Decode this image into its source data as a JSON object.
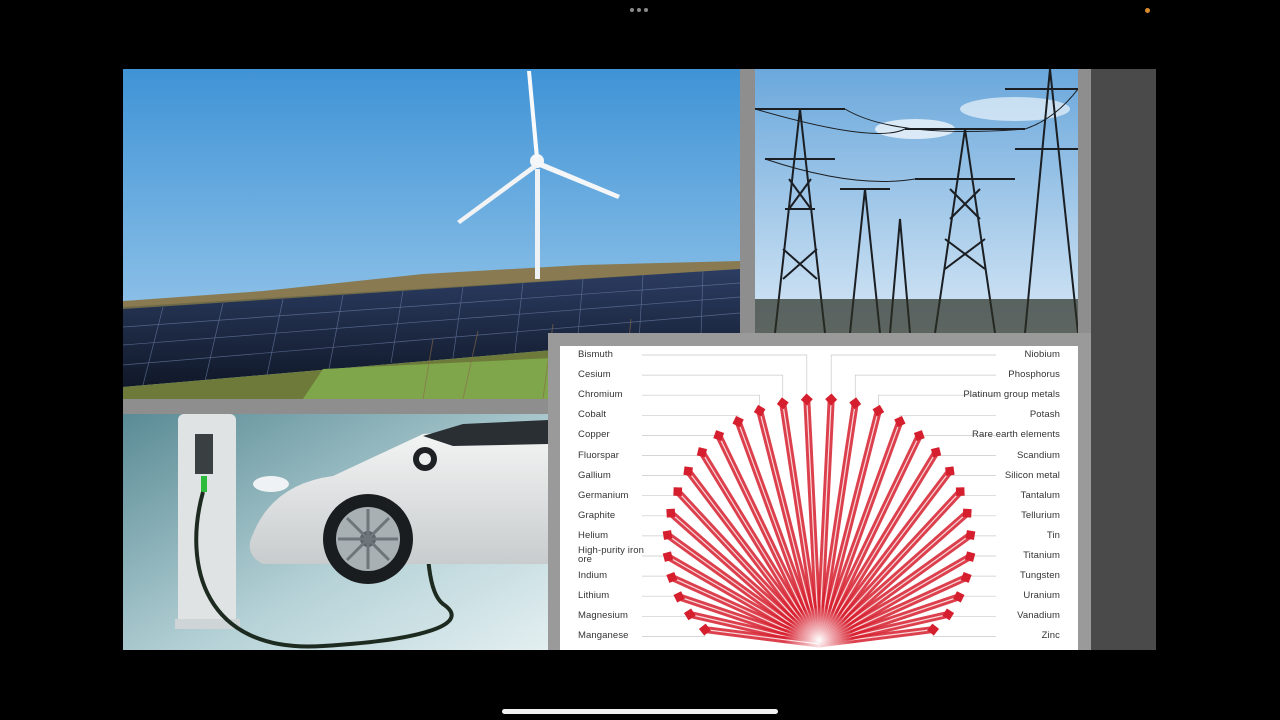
{
  "slide": {
    "panels": [
      {
        "id": "solar-wind",
        "icon": "solar-wind-photo"
      },
      {
        "id": "power-lines",
        "icon": "transmission-tower-photo"
      },
      {
        "id": "ev-charging",
        "icon": "electric-car-photo"
      },
      {
        "id": "critical-minerals",
        "icon": "maple-leaf-fan-graphic"
      }
    ]
  },
  "minerals": {
    "left": [
      "Bismuth",
      "Cesium",
      "Chromium",
      "Cobalt",
      "Copper",
      "Fluorspar",
      "Gallium",
      "Germanium",
      "Graphite",
      "Helium",
      "High-purity iron ore",
      "Indium",
      "Lithium",
      "Magnesium",
      "Manganese"
    ],
    "right": [
      "Niobium",
      "Phosphorus",
      "Platinum group metals",
      "Potash",
      "Rare earth elements",
      "Scandium",
      "Silicon metal",
      "Tantalum",
      "Tellurium",
      "Tin",
      "Titanium",
      "Tungsten",
      "Uranium",
      "Vanadium",
      "Zinc"
    ]
  },
  "colors": {
    "accent_red": "#d61f2e",
    "sky_blue": "#4a9cd8",
    "background": "#000000"
  }
}
